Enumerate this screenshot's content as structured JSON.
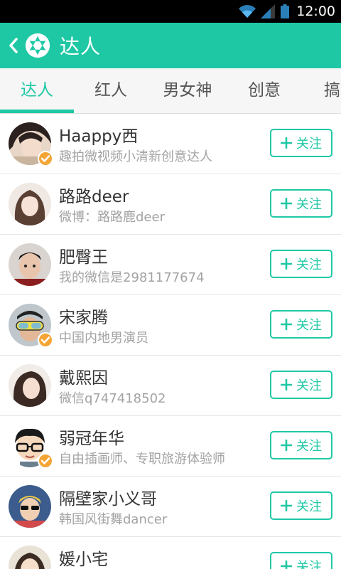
{
  "colors": {
    "accent": "#1fc8a5",
    "verified_badge": "#f4a535",
    "status_bar": "#000000"
  },
  "status_bar": {
    "time": "12:00",
    "icons": [
      "wifi-icon",
      "signal-icon",
      "battery-icon"
    ]
  },
  "app_bar": {
    "title": "达人",
    "back_icon": "chevron-left-icon",
    "logo_icon": "camera-aperture-icon"
  },
  "tabs": [
    {
      "label": "达人",
      "active": true
    },
    {
      "label": "红人",
      "active": false
    },
    {
      "label": "男女神",
      "active": false
    },
    {
      "label": "创意",
      "active": false
    },
    {
      "label": "搞",
      "active": false
    }
  ],
  "follow_label": "关注",
  "users": [
    {
      "name": "Haappy西",
      "desc": "趣拍微视频小清新创意达人",
      "verified": true
    },
    {
      "name": "路路deer",
      "desc": "微博：路路鹿deer",
      "verified": false
    },
    {
      "name": "肥臀王",
      "desc": "我的微信是2981177674",
      "verified": false
    },
    {
      "name": "宋家腾",
      "desc": "中国内地男演员",
      "verified": true
    },
    {
      "name": "戴熙因",
      "desc": "微信q747418502",
      "verified": false
    },
    {
      "name": "弱冠年华",
      "desc": "自由插画师、专职旅游体验师",
      "verified": true
    },
    {
      "name": "隔壁家小义哥",
      "desc": "韩国风街舞dancer",
      "verified": false
    },
    {
      "name": "媛小宅",
      "desc": "",
      "verified": false
    }
  ]
}
